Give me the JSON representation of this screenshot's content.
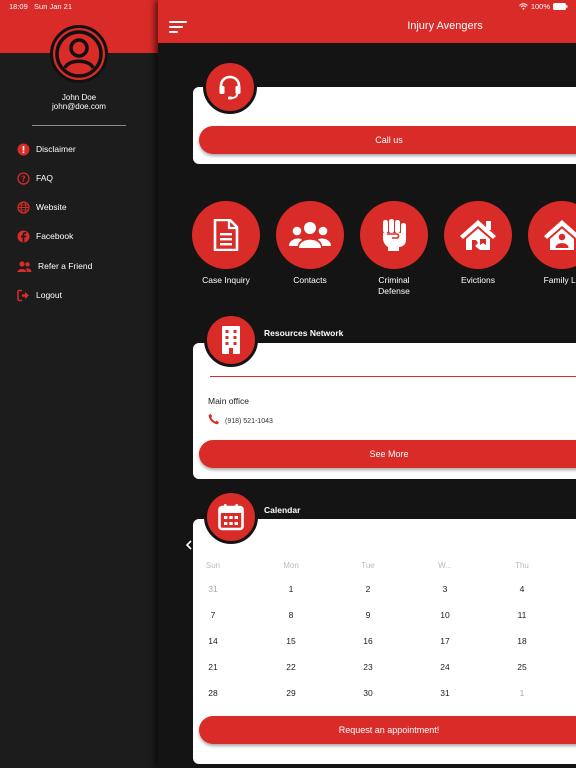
{
  "status": {
    "time": "18:09",
    "date": "Sun Jan 21",
    "battery": "100%"
  },
  "user": {
    "name": "John Doe",
    "email": "john@doe.com"
  },
  "sidebar": {
    "items": [
      {
        "label": "Disclaimer",
        "icon": "exclamation-icon"
      },
      {
        "label": "FAQ",
        "icon": "question-icon"
      },
      {
        "label": "Website",
        "icon": "globe-icon"
      },
      {
        "label": "Facebook",
        "icon": "facebook-icon"
      },
      {
        "label": "Refer a Friend",
        "icon": "users-icon"
      },
      {
        "label": "Logout",
        "icon": "logout-icon"
      }
    ]
  },
  "header": {
    "title": "Injury Avengers"
  },
  "call": {
    "button_label": "Call us"
  },
  "categories": [
    {
      "label": "Case Inquiry",
      "icon": "document-icon"
    },
    {
      "label": "Contacts",
      "icon": "group-icon"
    },
    {
      "label": "Criminal\nDefense",
      "icon": "fist-icon"
    },
    {
      "label": "Evictions",
      "icon": "house-broken-icon"
    },
    {
      "label": "Family La",
      "icon": "house-person-icon"
    }
  ],
  "resources": {
    "title": "Resources Network",
    "office_label": "Main office",
    "phone": "(918) 521-1043",
    "button_label": "See More"
  },
  "calendar": {
    "title": "Calendar",
    "weekdays": [
      "Sun",
      "Mon",
      "Tue",
      "W...",
      "Thu"
    ],
    "rows": [
      [
        "31",
        "1",
        "2",
        "3",
        "4"
      ],
      [
        "7",
        "8",
        "9",
        "10",
        "11"
      ],
      [
        "14",
        "15",
        "16",
        "17",
        "18"
      ],
      [
        "21",
        "22",
        "23",
        "24",
        "25"
      ],
      [
        "28",
        "29",
        "30",
        "31",
        "1"
      ]
    ],
    "button_label": "Request an appointment!"
  },
  "colors": {
    "accent": "#d92b27",
    "background": "#141414",
    "sidebar": "#1c1c1c"
  }
}
